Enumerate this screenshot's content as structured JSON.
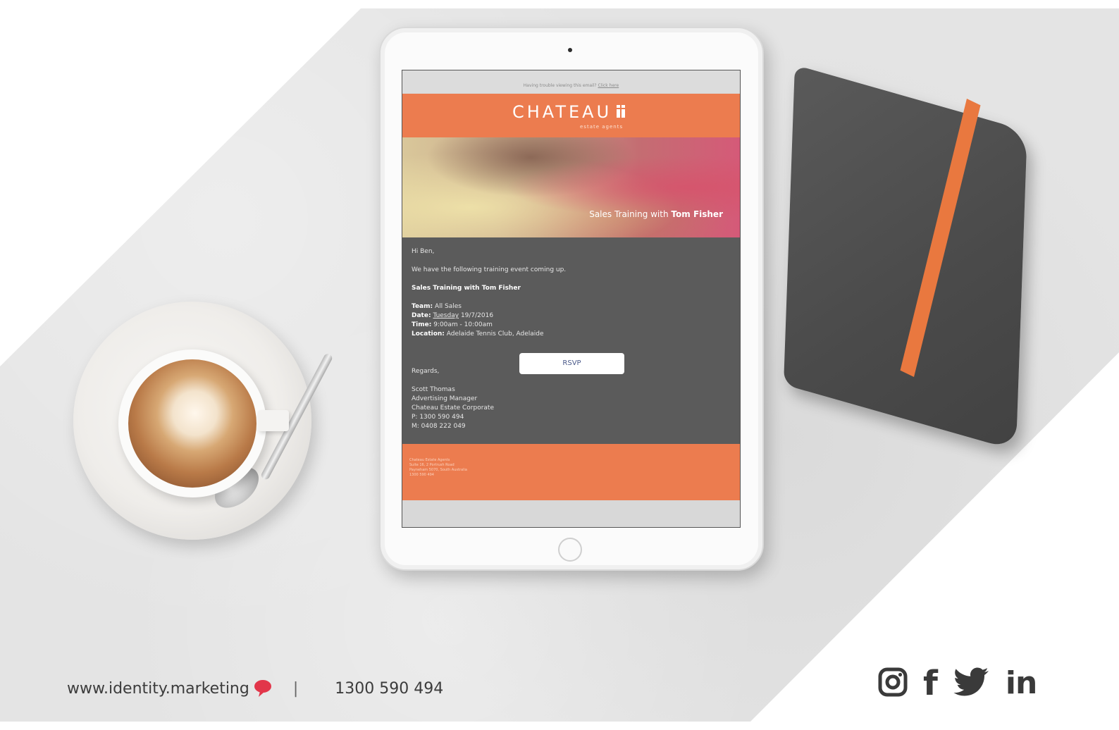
{
  "email": {
    "preheader_text": "Having trouble viewing this email?",
    "preheader_link": "Click here",
    "brand_name": "CHATEAU",
    "brand_sub": "estate agents",
    "hero_caption_prefix": "Sales Training with",
    "hero_caption_name": "Tom Fisher",
    "greeting": "Hi Ben,",
    "intro": "We have the following training event coming up.",
    "event_title": "Sales Training with Tom Fisher",
    "team_label": "Team:",
    "team_value": "All Sales",
    "date_label": "Date:",
    "date_day": "Tuesday",
    "date_value": "19/7/2016",
    "time_label": "Time:",
    "time_value": "9:00am - 10:00am",
    "location_label": "Location:",
    "location_value": "Adelaide Tennis Club, Adelaide",
    "rsvp_label": "RSVP",
    "regards": "Regards,",
    "sig_name": "Scott Thomas",
    "sig_title": "Advertising Manager",
    "sig_company": "Chateau Estate Corporate",
    "sig_phone": "P: 1300 590 494",
    "sig_mobile": "M: 0408 222 049",
    "footer_line1": "Chateau Estate Agents",
    "footer_line2": "Suite 16, 2 Portrush Road",
    "footer_line3": "Payneham 5070, South Australia",
    "footer_line4": "1300 590 494"
  },
  "site_footer": {
    "url": "www.identity.marketing",
    "divider": "|",
    "phone": "1300 590 494",
    "bubble_icon": "speech-bubble-icon",
    "bubble_color": "#e2364a"
  },
  "social": {
    "icons": [
      "instagram-icon",
      "facebook-icon",
      "twitter-icon",
      "linkedin-icon"
    ],
    "facebook_glyph": "f",
    "linkedin_glyph": "in"
  },
  "colors": {
    "accent_orange": "#ec7c4f",
    "email_body_gray": "#5b5b5b",
    "icon_dark": "#3a3a3a"
  }
}
